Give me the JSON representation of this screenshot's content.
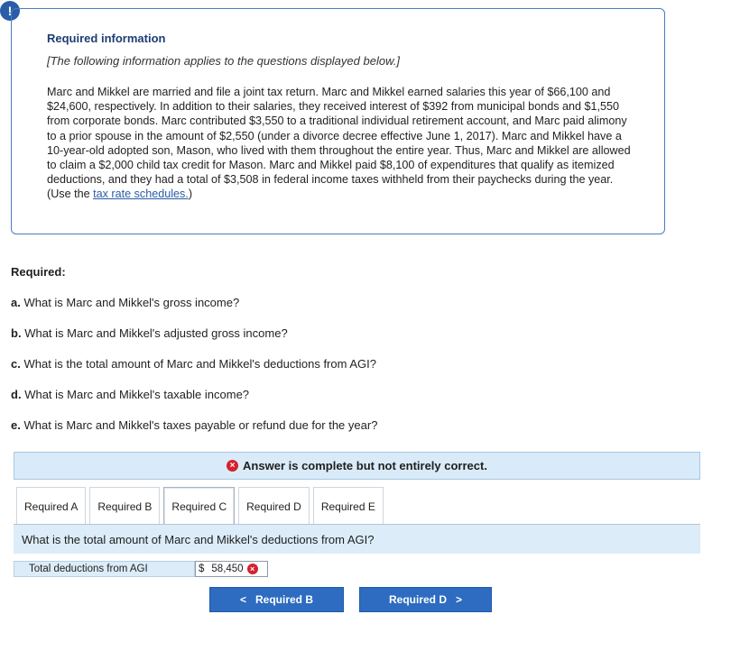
{
  "alert": {
    "icon": "exclamation-icon",
    "glyph": "!"
  },
  "info": {
    "title": "Required information",
    "note": "[The following information applies to the questions displayed below.]",
    "body_text": "Marc and Mikkel are married and file a joint tax return. Marc and Mikkel earned salaries this year of $66,100 and $24,600, respectively. In addition to their salaries, they received interest of $392 from municipal bonds and $1,550 from corporate bonds. Marc contributed $3,550 to a traditional individual retirement account, and Marc paid alimony to a prior spouse in the amount of $2,550 (under a divorce decree effective June 1, 2017). Marc and Mikkel have a 10-year-old adopted son, Mason, who lived with them throughout the entire year. Thus, Marc and Mikkel are allowed to claim a $2,000 child tax credit for Mason. Marc and Mikkel paid $8,100 of expenditures that qualify as itemized deductions, and they had a total of $3,508 in federal income taxes withheld from their paychecks during the year. (Use the ",
    "link_text": "tax rate schedules.",
    "body_end": ")"
  },
  "required": {
    "heading": "Required:",
    "questions": [
      {
        "letter": "a.",
        "text": "What is Marc and Mikkel's gross income?"
      },
      {
        "letter": "b.",
        "text": "What is Marc and Mikkel's adjusted gross income?"
      },
      {
        "letter": "c.",
        "text": "What is the total amount of Marc and Mikkel's deductions from AGI?"
      },
      {
        "letter": "d.",
        "text": "What is Marc and Mikkel's taxable income?"
      },
      {
        "letter": "e.",
        "text": "What is Marc and Mikkel's taxes payable or refund due for the year?"
      }
    ]
  },
  "status": {
    "icon": "error-x-icon",
    "glyph": "×",
    "text": "Answer is complete but not entirely correct."
  },
  "tabs": [
    {
      "label": "Required A"
    },
    {
      "label": "Required B"
    },
    {
      "label": "Required C",
      "active": true
    },
    {
      "label": "Required D"
    },
    {
      "label": "Required E"
    }
  ],
  "question": {
    "text": "What is the total amount of Marc and Mikkel's deductions from AGI?"
  },
  "answer": {
    "label": "Total deductions from AGI",
    "currency": "$",
    "value": "58,450",
    "status_icon": "error-x-icon",
    "status_glyph": "×"
  },
  "nav": {
    "prev_label": "Required B",
    "prev_glyph": "<",
    "next_label": "Required D",
    "next_glyph": ">"
  }
}
